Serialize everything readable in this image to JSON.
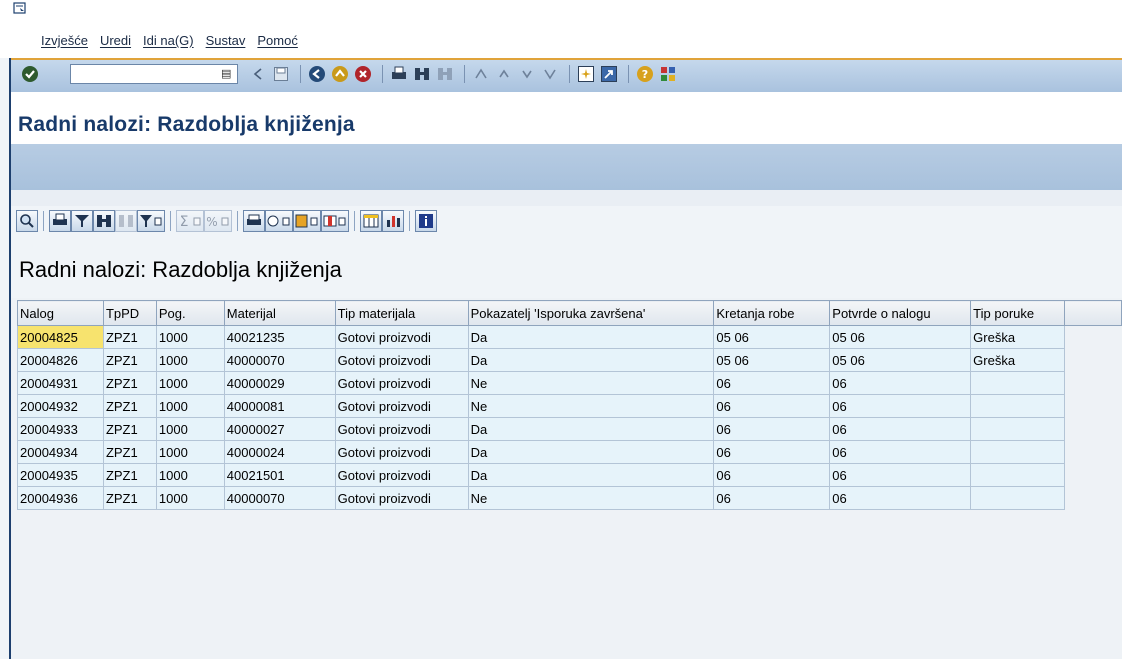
{
  "menu": [
    "Izvješće",
    "Uredi",
    "Idi na(G)",
    "Sustav",
    "Pomoć"
  ],
  "system_toolbar": {
    "command_field_value": "",
    "icons": [
      "enter-icon",
      "back-icon",
      "exit-icon",
      "cancel-icon",
      "print-icon",
      "find-icon",
      "find-next-icon",
      "first-page-icon",
      "previous-page-icon",
      "next-page-icon",
      "last-page-icon",
      "new-session-icon",
      "shortcut-icon",
      "help-icon",
      "customize-layout-icon"
    ]
  },
  "page_title": "Radni nalozi: Razdoblja knjiženja",
  "report": {
    "title": "Radni nalozi: Razdoblja knjiženja",
    "columns": [
      "Nalog",
      "TpPD",
      "Pog.",
      "Materijal",
      "Tip materijala",
      "Pokazatelj 'Isporuka završena'",
      "Kretanja robe",
      "Potvrde o nalogu",
      "Tip poruke"
    ],
    "rows": [
      [
        "20004825",
        "ZPZ1",
        "1000",
        "40021235",
        "Gotovi proizvodi",
        "Da",
        "05 06",
        "05 06",
        "Greška"
      ],
      [
        "20004826",
        "ZPZ1",
        "1000",
        "40000070",
        "Gotovi proizvodi",
        "Da",
        "05 06",
        "05 06",
        "Greška"
      ],
      [
        "20004931",
        "ZPZ1",
        "1000",
        "40000029",
        "Gotovi proizvodi",
        "Ne",
        "06",
        "06",
        ""
      ],
      [
        "20004932",
        "ZPZ1",
        "1000",
        "40000081",
        "Gotovi proizvodi",
        "Ne",
        "06",
        "06",
        ""
      ],
      [
        "20004933",
        "ZPZ1",
        "1000",
        "40000027",
        "Gotovi proizvodi",
        "Da",
        "06",
        "06",
        ""
      ],
      [
        "20004934",
        "ZPZ1",
        "1000",
        "40000024",
        "Gotovi proizvodi",
        "Da",
        "06",
        "06",
        ""
      ],
      [
        "20004935",
        "ZPZ1",
        "1000",
        "40021501",
        "Gotovi proizvodi",
        "Da",
        "06",
        "06",
        ""
      ],
      [
        "20004936",
        "ZPZ1",
        "1000",
        "40000070",
        "Gotovi proizvodi",
        "Ne",
        "06",
        "06",
        ""
      ]
    ]
  },
  "colors": {
    "title_blue": "#183a6a",
    "toolbar_blue": "#a9c2de",
    "accent_orange": "#e0a33a",
    "cell_bg": "#e6f3fa",
    "selected_cell": "#f7e36e"
  }
}
